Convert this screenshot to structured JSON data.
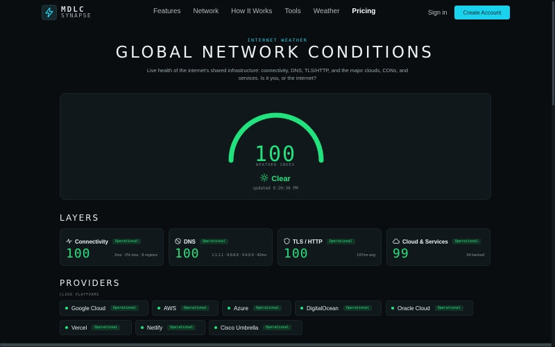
{
  "header": {
    "logo_main": "MDLC",
    "logo_sub": "SYNAPSE",
    "nav": [
      "Features",
      "Network",
      "How It Works",
      "Tools",
      "Weather",
      "Pricing"
    ],
    "active_nav": "Pricing",
    "sign_in": "Sign in",
    "create_account": "Create Account"
  },
  "hero": {
    "eyebrow": "INTERNET WEATHER",
    "title": "GLOBAL NETWORK CONDITIONS",
    "subtitle": "Live health of the internet's shared infrastructure: connectivity, DNS, TLS/HTTP, and the major clouds, CDNs, and services. Is it you, or the internet?"
  },
  "gauge": {
    "value": "100",
    "level": 1.0,
    "label": "WEATHER INDEX",
    "status": "Clear",
    "updated": "updated 9:20:30 PM",
    "color": "#21e37e"
  },
  "layers": {
    "title": "LAYERS",
    "items": [
      {
        "name": "Connectivity",
        "badge": "Operational",
        "value": "100",
        "meta": "2ms · 0% loss · 8 regions",
        "icon": "activity-icon"
      },
      {
        "name": "DNS",
        "badge": "Operational",
        "value": "100",
        "meta": "1.1.1.1 · 8.8.8.8 · 9.9.9.9 · 42ms",
        "icon": "globe-icon"
      },
      {
        "name": "TLS / HTTP",
        "badge": "Operational",
        "value": "100",
        "meta": "197ms avg",
        "icon": "shield-icon"
      },
      {
        "name": "Cloud & Services",
        "badge": "Operational",
        "value": "99",
        "meta": "34 tracked",
        "icon": "cloud-icon"
      }
    ]
  },
  "providers": {
    "title": "PROVIDERS",
    "group_label": "CLOUD PLATFORMS",
    "items": [
      {
        "name": "Google Cloud",
        "badge": "Operational"
      },
      {
        "name": "AWS",
        "badge": "Operational"
      },
      {
        "name": "Azure",
        "badge": "Operational"
      },
      {
        "name": "DigitalOcean",
        "badge": "Operational"
      },
      {
        "name": "Oracle Cloud",
        "badge": "Operational"
      },
      {
        "name": "Vercel",
        "badge": "Operational"
      },
      {
        "name": "Netlify",
        "badge": "Operational"
      },
      {
        "name": "Cisco Umbrella",
        "badge": "Operational"
      }
    ]
  }
}
